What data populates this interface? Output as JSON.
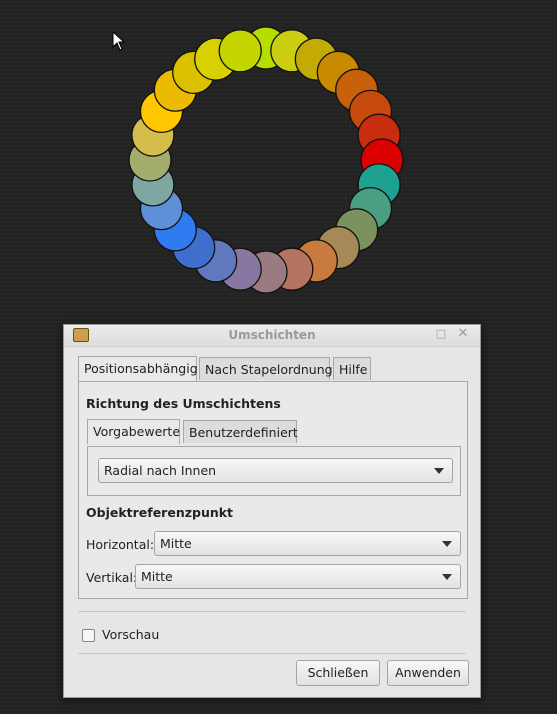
{
  "canvas": {
    "circle_colors": [
      "#b5dd00",
      "#cbce10",
      "#c4aa04",
      "#c88b00",
      "#c7620a",
      "#c64a0c",
      "#c92d10",
      "#dd0000",
      "#1ea290",
      "#4a9e82",
      "#79925e",
      "#a78958",
      "#c87a3f",
      "#b57460",
      "#9b7b82",
      "#8877a0",
      "#6078c0",
      "#3f6fcc",
      "#2e7cf0",
      "#5d90d6",
      "#7fa6a0",
      "#a3ad6c",
      "#d6bc4a",
      "#ffc700",
      "#ecbb00",
      "#dcc000",
      "#d8d000",
      "#c5d500"
    ]
  },
  "dialog": {
    "title": "Umschichten",
    "tabs": [
      "Positionsabhängig",
      "Nach Stapelordnung",
      "Hilfe"
    ],
    "direction_section": "Richtung des Umschichtens",
    "inner_tabs": [
      "Vorgabewerte",
      "Benutzerdefiniert"
    ],
    "direction_value": "Radial nach Innen",
    "reference_section": "Objektreferenzpunkt",
    "horizontal_label": "Horizontal:",
    "horizontal_value": "Mitte",
    "vertical_label": "Vertikal:",
    "vertical_value": "Mitte",
    "preview_label": "Vorschau",
    "close_button": "Schließen",
    "apply_button": "Anwenden"
  }
}
